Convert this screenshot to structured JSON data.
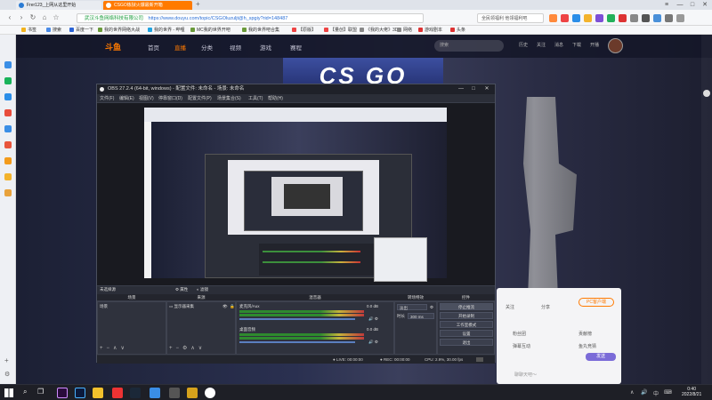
{
  "browser": {
    "tabs": [
      {
        "label": "Frer123_上网从这里开始",
        "active": false
      },
      {
        "label": "CSGO炼狱火爆最新开箱",
        "active": true
      }
    ],
    "tab_add": "+",
    "window_controls": {
      "menu": "≡",
      "min": "—",
      "max": "□",
      "close": "✕"
    },
    "nav": {
      "back": "‹",
      "forward": "›",
      "refresh": "↻",
      "home": "⌂",
      "fav": "☆"
    },
    "url": {
      "secure_label": "武汉斗鱼网络科技有限公司",
      "address": "https://www.douyu.com/topic/CSGOluzuljt@h_spgiy?rid=148487"
    },
    "search_placeholder": "全民领福利 他领福利吧",
    "bookmarks": [
      "书签",
      "搜索",
      "百度一下",
      "我的世界网络大战",
      "我的世界 - 哔哩",
      "MC我的世界开吧",
      "我的世界吧合集",
      "【原版】",
      "【量创】联盟",
      "《我的大佬》3D",
      "网络",
      "游戏剧本",
      "头条"
    ]
  },
  "site": {
    "logo": "斗鱼",
    "nav": [
      "首页",
      "直播",
      "分类",
      "视频",
      "游戏",
      "赛程"
    ],
    "active_nav": 1,
    "search_placeholder": "搜索",
    "header_icons": [
      "历史",
      "关注",
      "消息",
      "下载",
      "开播"
    ],
    "banner": "CS GO",
    "right_panel": {
      "items": [
        "关注",
        "分享",
        "鱼丸"
      ],
      "pc_button": "PC客户端",
      "rows": [
        "粉丝团",
        "贡献榜",
        "弹幕互动",
        "鱼丸竞猜"
      ],
      "send_btn": "发送",
      "input_hint": "聊聊天吧～"
    }
  },
  "obs": {
    "title": "OBS 27.2.4 (64-bit, windows) - 配置文件: 未命名 - 场景: 未命名",
    "window_controls": {
      "min": "—",
      "max": "□",
      "close": "✕"
    },
    "menu": [
      "文件(F)",
      "编辑(E)",
      "视图(V)",
      "停靠窗口(D)",
      "配置文件(P)",
      "场景集合(S)",
      "工具(T)",
      "帮助(H)"
    ],
    "source_bar": {
      "label": "未选择源",
      "props": "属性",
      "filters": "滤镜"
    },
    "docks": {
      "scenes": "场景",
      "sources": "来源",
      "mixer": "混音器",
      "transitions": "转场特效",
      "controls": "控件"
    },
    "scene_items": [
      "场景"
    ],
    "source_items": [
      "显示器采集"
    ],
    "mixer_channels": [
      {
        "name": "麦克风/Aux",
        "db": "0.0 dB",
        "level": 0.8
      },
      {
        "name": "桌面音频",
        "db": "0.0 dB",
        "level": 0.7
      }
    ],
    "transition": {
      "type": "淡出",
      "duration_label": "时长",
      "duration": "300 ms"
    },
    "controls": [
      "停止推流",
      "开始录制",
      "工作室模式",
      "设置",
      "退出"
    ],
    "status": {
      "live_label": "LIVE:",
      "live_time": "00:00:00",
      "rec_label": "REC:",
      "rec_time": "00:00:00",
      "cpu": "CPU: 2.9%, 30.00 fps"
    },
    "dock_buttons": [
      "+",
      "−",
      "∧",
      "∨"
    ]
  },
  "taskbar": {
    "time": "0:40",
    "date": "2022/8/21",
    "tray": [
      "∧",
      "🔊",
      "中",
      "⌨"
    ]
  },
  "colors": {
    "accent": "#ff7a00",
    "obs_bg": "#2b2e38",
    "meter_green": "#2e8a2e"
  }
}
